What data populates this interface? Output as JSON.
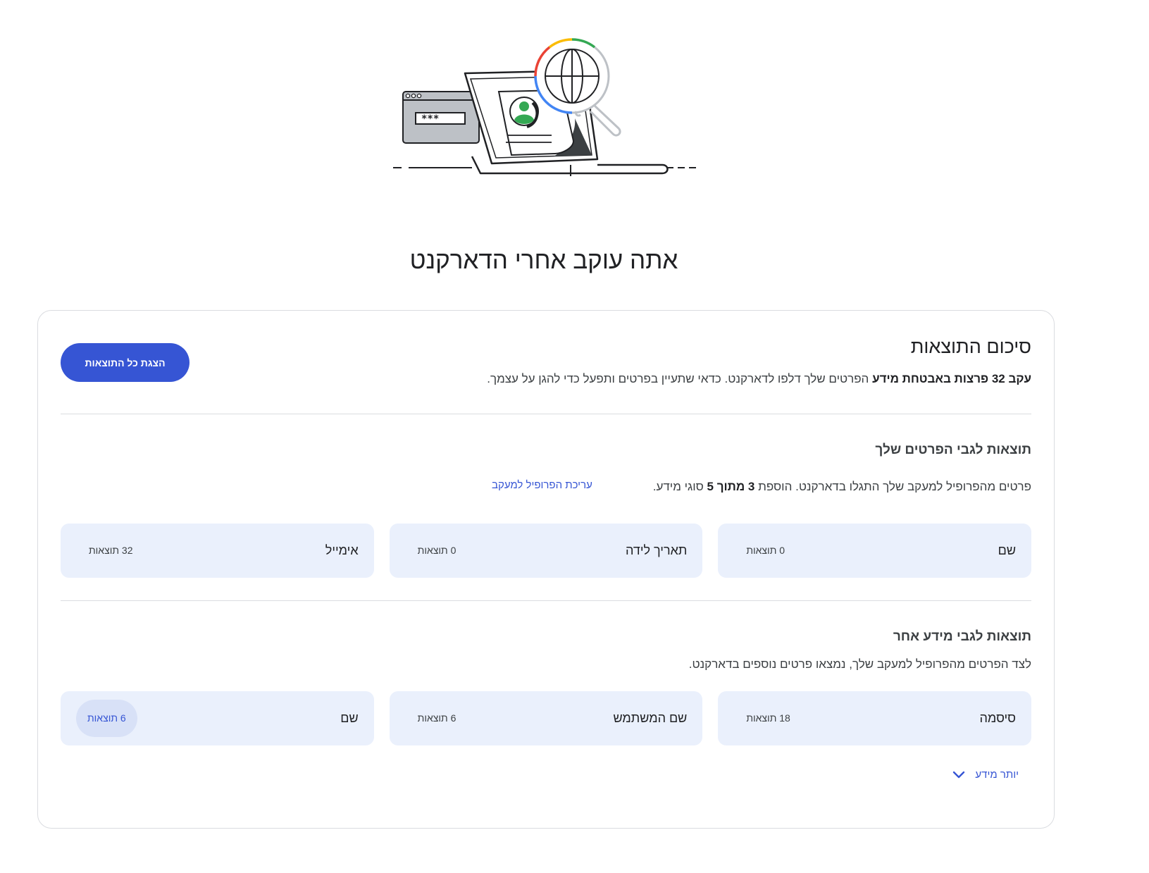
{
  "page": {
    "title": "אתה עוקב אחרי הדארקנט"
  },
  "summary": {
    "title": "סיכום התוצאות",
    "text_bold": "עקב 32 פרצות באבטחת מידע",
    "text_rest": " הפרטים שלך דלפו לדארקנט. כדאי שתעיין בפרטים ותפעל כדי להגן על עצמך.",
    "show_all_label": "הצגת כל התוצאות"
  },
  "profile_section": {
    "title": "תוצאות לגבי הפרטים שלך",
    "text_part1": "פרטים מהפרופיל למעקב שלך התגלו בדארקנט. הוספת ",
    "text_bold": "3 מתוך 5",
    "text_part2": " סוגי מידע.",
    "edit_link": "עריכת הפרופיל למעקב",
    "tiles": [
      {
        "label": "שם",
        "count": "0 תוצאות"
      },
      {
        "label": "תאריך לידה",
        "count": "0 תוצאות"
      },
      {
        "label": "אימייל",
        "count": "32 תוצאות"
      }
    ]
  },
  "other_section": {
    "title": "תוצאות לגבי מידע אחר",
    "text": "לצד הפרטים מהפרופיל למעקב שלך, נמצאו פרטים נוספים בדארקנט.",
    "tiles": [
      {
        "label": "סיסמה",
        "count": "18 תוצאות"
      },
      {
        "label": "שם המשתמש",
        "count": "6 תוצאות"
      },
      {
        "label": "שם",
        "count": "6 תוצאות"
      }
    ],
    "more_label": "יותר מידע"
  },
  "illustration": {
    "password_mask": "***"
  },
  "colors": {
    "accent": "#3655d4",
    "tile_bg": "#eaf0fc",
    "pill_bg": "#d8e1f7",
    "border": "#dadce0",
    "google_red": "#ea4335",
    "google_yellow": "#fbbc04",
    "google_green": "#34a853",
    "google_blue": "#4285f4"
  },
  "icons": [
    "dark-web-illustration",
    "globe-icon",
    "magnifier-icon",
    "user-avatar-icon",
    "password-window-icon",
    "chevron-down-icon"
  ]
}
